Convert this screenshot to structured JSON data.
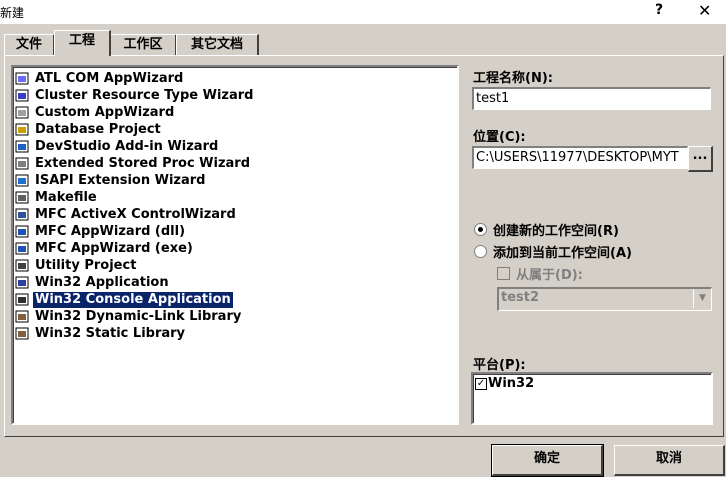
{
  "window": {
    "title": "新建",
    "help_label": "?",
    "close_label": "✕"
  },
  "tabs": [
    {
      "label": "文件"
    },
    {
      "label": "工程"
    },
    {
      "label": "工作区"
    },
    {
      "label": "其它文档"
    }
  ],
  "projects": [
    {
      "label": "ATL COM AppWizard",
      "icon": "atl-com-icon"
    },
    {
      "label": "Cluster Resource Type Wizard",
      "icon": "cluster-icon"
    },
    {
      "label": "Custom AppWizard",
      "icon": "custom-wizard-icon"
    },
    {
      "label": "Database Project",
      "icon": "database-icon"
    },
    {
      "label": "DevStudio Add-in Wizard",
      "icon": "addin-icon"
    },
    {
      "label": "Extended Stored Proc Wizard",
      "icon": "stored-proc-icon"
    },
    {
      "label": "ISAPI Extension Wizard",
      "icon": "isapi-globe-icon"
    },
    {
      "label": "Makefile",
      "icon": "makefile-icon"
    },
    {
      "label": "MFC ActiveX ControlWizard",
      "icon": "activex-icon"
    },
    {
      "label": "MFC AppWizard (dll)",
      "icon": "mfc-dll-icon"
    },
    {
      "label": "MFC AppWizard (exe)",
      "icon": "mfc-exe-icon"
    },
    {
      "label": "Utility Project",
      "icon": "utility-icon"
    },
    {
      "label": "Win32 Application",
      "icon": "win32-app-icon"
    },
    {
      "label": "Win32 Console Application",
      "icon": "console-icon"
    },
    {
      "label": "Win32 Dynamic-Link Library",
      "icon": "dll-icon"
    },
    {
      "label": "Win32 Static Library",
      "icon": "static-lib-icon"
    }
  ],
  "selected_project": "Win32 Console Application",
  "project_name": {
    "label": "工程名称(N):",
    "value": "test1"
  },
  "location": {
    "label": "位置(C):",
    "value": "C:\\USERS\\11977\\DESKTOP\\MYT",
    "browse_label": "..."
  },
  "workspace": {
    "create_new_label": "创建新的工作空间(R)",
    "add_to_current_label": "添加到当前工作空间(A)",
    "dependency_label": "从属于(D):",
    "dependency_value": "test2",
    "selected": "create_new"
  },
  "platform": {
    "label": "平台(P):",
    "items": [
      {
        "label": "Win32",
        "checked": true
      }
    ]
  },
  "buttons": {
    "ok_label": "确定",
    "cancel_label": "取消"
  },
  "colors": {
    "face": "#d4d0c8",
    "selection": "#0a246a",
    "shadow": "#808080"
  }
}
